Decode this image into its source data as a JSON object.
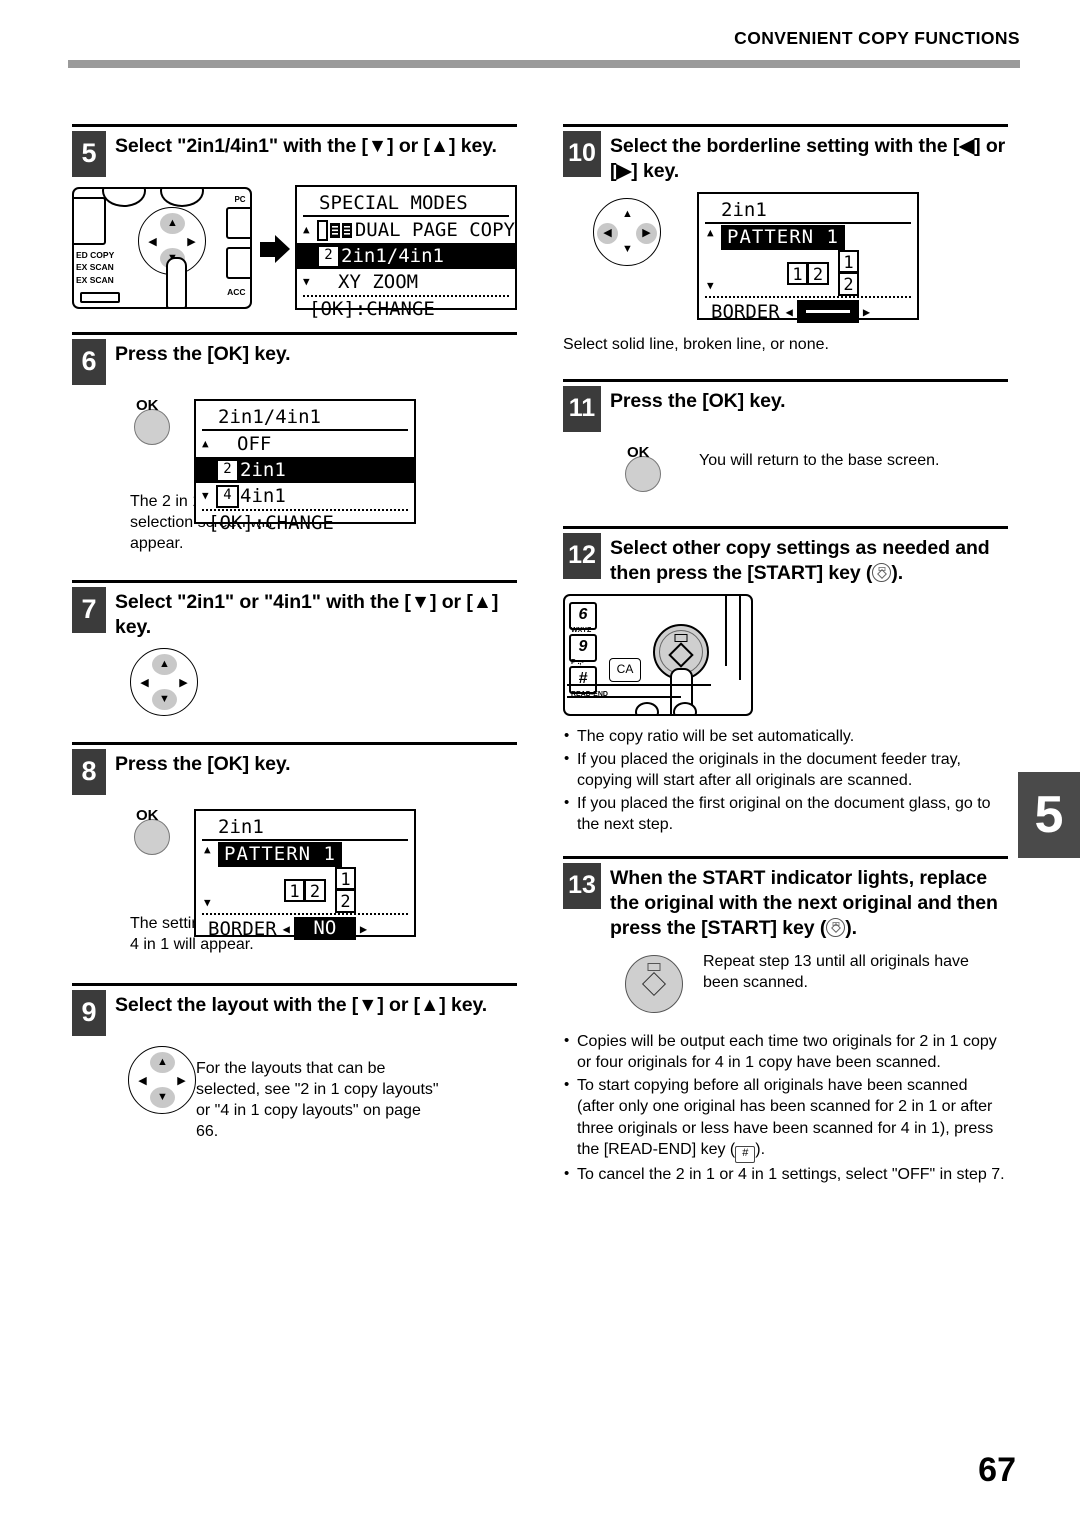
{
  "header": {
    "title": "CONVENIENT COPY FUNCTIONS"
  },
  "chapter_tab": "5",
  "page_number": "67",
  "steps": {
    "s5": {
      "number": "5",
      "title": "Select \"2in1/4in1\" with the [▼] or [▲] key.",
      "panel_labels": {
        "l1": "ED COPY",
        "l2": "EX SCAN",
        "l3": "EX SCAN",
        "pc": "PC",
        "acc": "ACC"
      },
      "lcd": {
        "title": "SPECIAL MODES",
        "rows": [
          {
            "mark": "▲",
            "icon": "checkbox-book-icon",
            "label": "DUAL PAGE COPY",
            "selected": false
          },
          {
            "mark": "",
            "icon": "two-up-icon",
            "label": "2in1/4in1",
            "selected": true
          },
          {
            "mark": "▼",
            "icon": "",
            "label": "XY ZOOM",
            "selected": false
          }
        ],
        "footer": "[OK]:CHANGE"
      }
    },
    "s6": {
      "number": "6",
      "title": "Press the [OK] key.",
      "ok_label": "OK",
      "note": "The 2 in 1 / 4 in 1 selection screen will appear.",
      "lcd": {
        "title": "2in1/4in1",
        "rows": [
          {
            "mark": "▲",
            "icon": "",
            "label": "OFF",
            "selected": false
          },
          {
            "mark": "",
            "icon": "two-up-icon",
            "label": "2in1",
            "selected": true
          },
          {
            "mark": "▼",
            "icon": "four-up-icon",
            "label": "4in1",
            "selected": false
          }
        ],
        "footer": "[OK]:CHANGE"
      }
    },
    "s7": {
      "number": "7",
      "title": "Select \"2in1\" or \"4in1\" with the [▼] or [▲] key."
    },
    "s8": {
      "number": "8",
      "title": "Press the [OK] key.",
      "ok_label": "OK",
      "note": "The settings for 2 in 1 or 4 in 1 will appear.",
      "lcd": {
        "title": "2in1",
        "pattern_label": "PATTERN 1",
        "pattern_h": [
          "1",
          "2"
        ],
        "pattern_v": [
          "1",
          "2"
        ],
        "border_label": "BORDER",
        "border_value": "NO",
        "border_value_type": "text"
      }
    },
    "s9": {
      "number": "9",
      "title": "Select the layout with the [▼] or [▲] key.",
      "note": "For the layouts that can be selected, see \"2 in 1 copy layouts\" or \"4 in 1 copy layouts\" on page 66."
    },
    "s10": {
      "number": "10",
      "title": "Select the borderline setting with the [◀] or [▶] key.",
      "note": "Select solid line, broken line, or none.",
      "lcd": {
        "title": "2in1",
        "pattern_label": "PATTERN 1",
        "pattern_h": [
          "1",
          "2"
        ],
        "pattern_v": [
          "1",
          "2"
        ],
        "border_label": "BORDER",
        "border_value": "",
        "border_value_type": "solid-line"
      }
    },
    "s11": {
      "number": "11",
      "title": "Press the [OK] key.",
      "ok_label": "OK",
      "note": "You will return to the base screen."
    },
    "s12": {
      "number": "12",
      "title_part1": "Select other copy settings as needed and then press the [START] key (",
      "title_part2": ").",
      "keypad": {
        "key6": "6",
        "key6_sub": "WXYZ",
        "key9": "9",
        "key9_sub": "P .,-",
        "keyhash": "#",
        "keyhash_sub": "READ-END",
        "ca": "CA"
      },
      "bullets": [
        "The copy ratio will be set automatically.",
        "If you placed the originals in the document feeder tray, copying will start after all originals are scanned.",
        "If you placed the first original on the document glass, go to the next step."
      ]
    },
    "s13": {
      "number": "13",
      "title_part1": "When the START indicator lights, replace the original with the next original and then press the [START] key (",
      "title_part2": ").",
      "note": "Repeat step 13 until all originals have been scanned.",
      "bullets": [
        "Copies will be output each time two originals for 2 in 1 copy or four originals for 4 in 1 copy have been scanned.",
        "To start copying before all originals have been scanned (after only one original has been scanned for 2 in 1 or after three originals or less have been scanned for 4 in 1), press the [READ-END] key (#).",
        "To cancel the 2 in 1 or 4 in 1 settings, select \"OFF\" in step 7."
      ],
      "bullet2_pre": "To start copying before all originals have been scanned (after only one original has been scanned for 2 in 1 or after three originals or less have been scanned for 4 in 1), press the [READ-END] key (",
      "bullet2_key": "#",
      "bullet2_post": ")."
    }
  }
}
